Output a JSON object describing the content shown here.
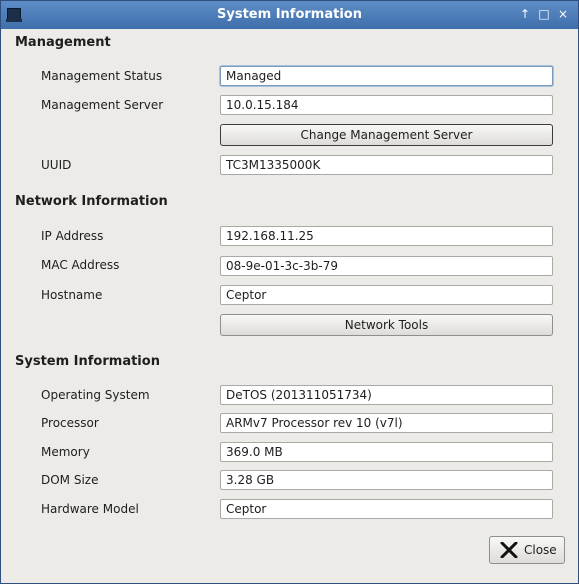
{
  "window": {
    "title": "System Information",
    "controls": {
      "pin": "↑",
      "maximize": "□",
      "close": "×"
    }
  },
  "management": {
    "heading": "Management",
    "status_label": "Management Status",
    "status_value": "Managed",
    "server_label": "Management Server",
    "server_value": "10.0.15.184",
    "change_server_button": "Change Management Server",
    "uuid_label": "UUID",
    "uuid_value": "TC3M1335000K"
  },
  "network": {
    "heading": "Network Information",
    "ip_label": "IP Address",
    "ip_value": "192.168.11.25",
    "mac_label": "MAC Address",
    "mac_value": "08-9e-01-3c-3b-79",
    "hostname_label": "Hostname",
    "hostname_value": "Ceptor",
    "tools_button": "Network Tools"
  },
  "system": {
    "heading": "System Information",
    "os_label": "Operating System",
    "os_value": "DeTOS (201311051734)",
    "processor_label": "Processor",
    "processor_value": "ARMv7 Processor rev 10 (v7l)",
    "memory_label": "Memory",
    "memory_value": "369.0 MB",
    "dom_label": "DOM Size",
    "dom_value": "3.28 GB",
    "hardware_label": "Hardware Model",
    "hardware_value": "Ceptor"
  },
  "footer": {
    "close_label": "Close"
  }
}
